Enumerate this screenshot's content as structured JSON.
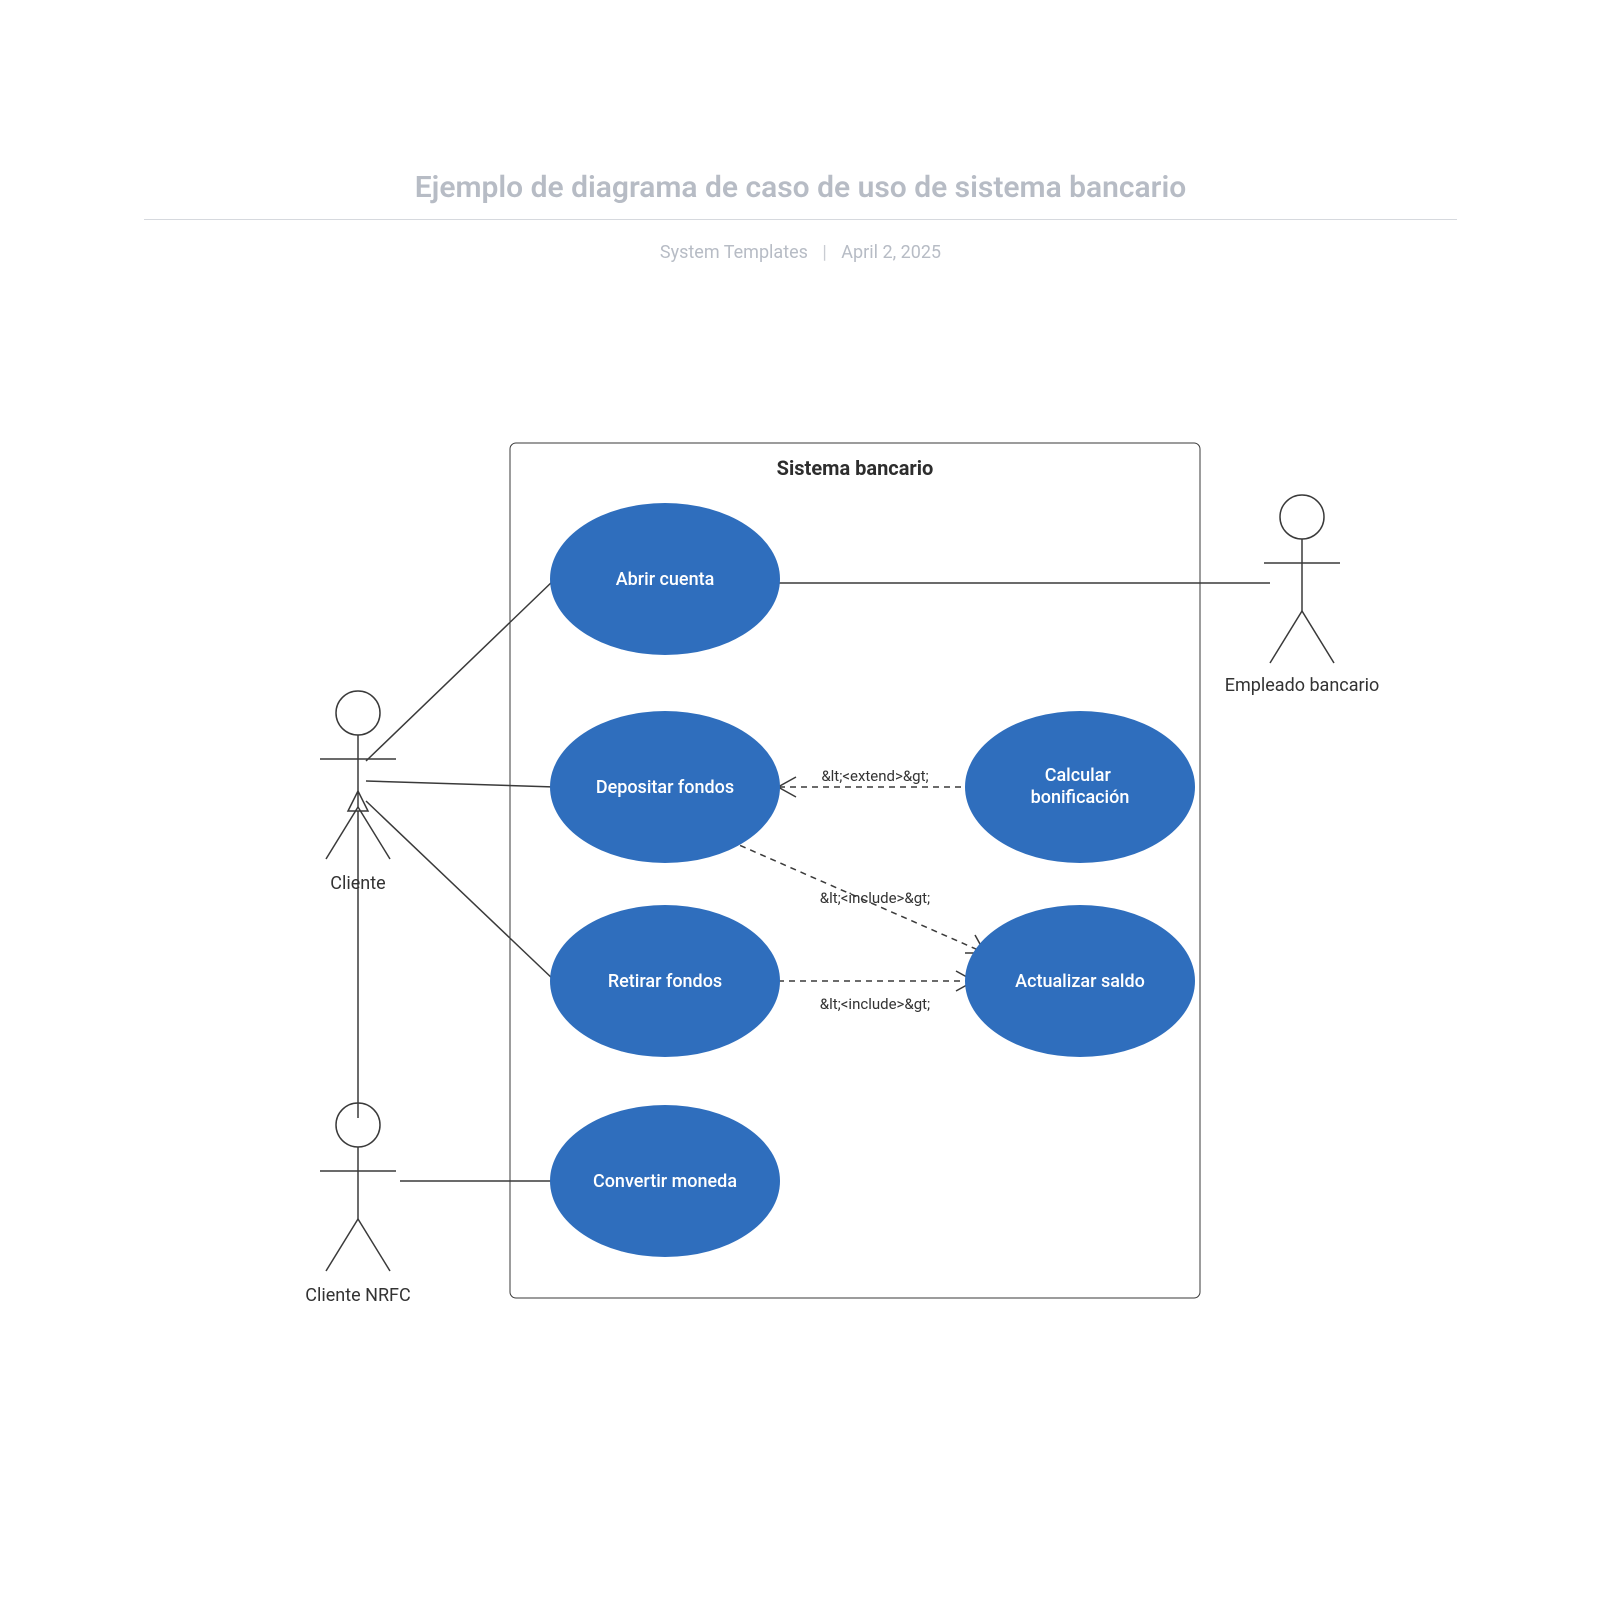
{
  "header": {
    "title": "Ejemplo de diagrama de caso de uso de sistema bancario",
    "author": "System Templates",
    "date": "April 2, 2025"
  },
  "diagram": {
    "system_label": "Sistema bancario",
    "actors": {
      "cliente": "Cliente",
      "cliente_nrfc": "Cliente NRFC",
      "empleado": "Empleado bancario"
    },
    "usecases": {
      "abrir_cuenta": "Abrir cuenta",
      "depositar_fondos": "Depositar fondos",
      "retirar_fondos": "Retirar fondos",
      "convertir_moneda": "Convertir moneda",
      "calcular_bonificacion": "Calcular bonificación",
      "actualizar_saldo": "Actualizar saldo"
    },
    "relations": {
      "extend": "&lt;<extend>&gt;",
      "include": "&lt;<include>&gt;"
    },
    "colors": {
      "usecase_fill": "#2f6ebd"
    }
  }
}
